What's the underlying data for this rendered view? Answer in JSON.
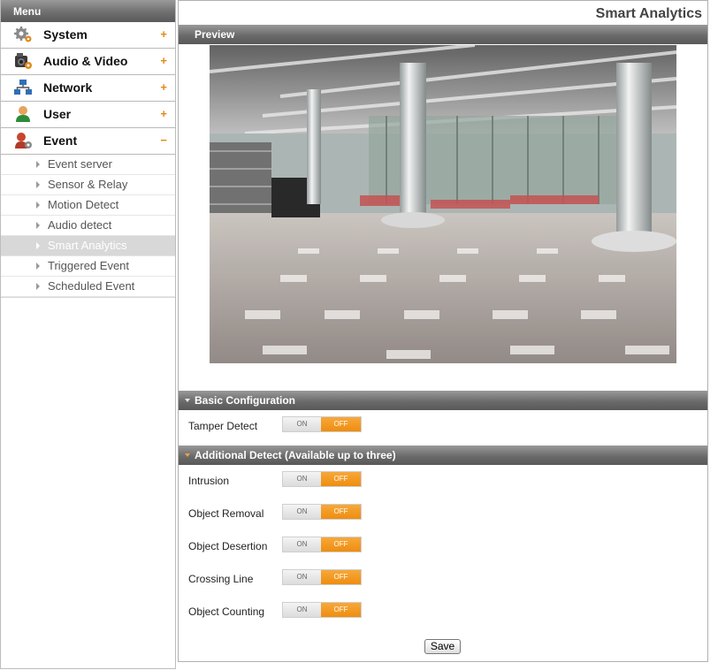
{
  "sidebar": {
    "header": "Menu",
    "items": [
      {
        "label": "System",
        "toggle": "+",
        "icon": "gear-icon"
      },
      {
        "label": "Audio & Video",
        "toggle": "+",
        "icon": "camera-icon"
      },
      {
        "label": "Network",
        "toggle": "+",
        "icon": "network-icon"
      },
      {
        "label": "User",
        "toggle": "+",
        "icon": "user-icon"
      },
      {
        "label": "Event",
        "toggle": "−",
        "icon": "event-icon"
      }
    ],
    "event_submenu": [
      {
        "label": "Event server"
      },
      {
        "label": "Sensor & Relay"
      },
      {
        "label": "Motion Detect"
      },
      {
        "label": "Audio detect"
      },
      {
        "label": "Smart Analytics",
        "active": true
      },
      {
        "label": "Triggered Event"
      },
      {
        "label": "Scheduled Event"
      }
    ]
  },
  "main": {
    "title": "Smart Analytics",
    "preview": {
      "header": "Preview"
    },
    "basic": {
      "header": "Basic Configuration",
      "tamper": {
        "label": "Tamper Detect",
        "on": "ON",
        "off": "OFF"
      }
    },
    "additional": {
      "header": "Additional Detect (Available up to three)",
      "rows": [
        {
          "label": "Intrusion",
          "on": "ON",
          "off": "OFF"
        },
        {
          "label": "Object Removal",
          "on": "ON",
          "off": "OFF"
        },
        {
          "label": "Object Desertion",
          "on": "ON",
          "off": "OFF"
        },
        {
          "label": "Crossing Line",
          "on": "ON",
          "off": "OFF"
        },
        {
          "label": "Object Counting",
          "on": "ON",
          "off": "OFF"
        }
      ]
    },
    "save_label": "Save"
  },
  "colors": {
    "accent": "#ee8d10",
    "header_gray": "#6b6b6b",
    "active_sub": "#d8d8d8"
  }
}
